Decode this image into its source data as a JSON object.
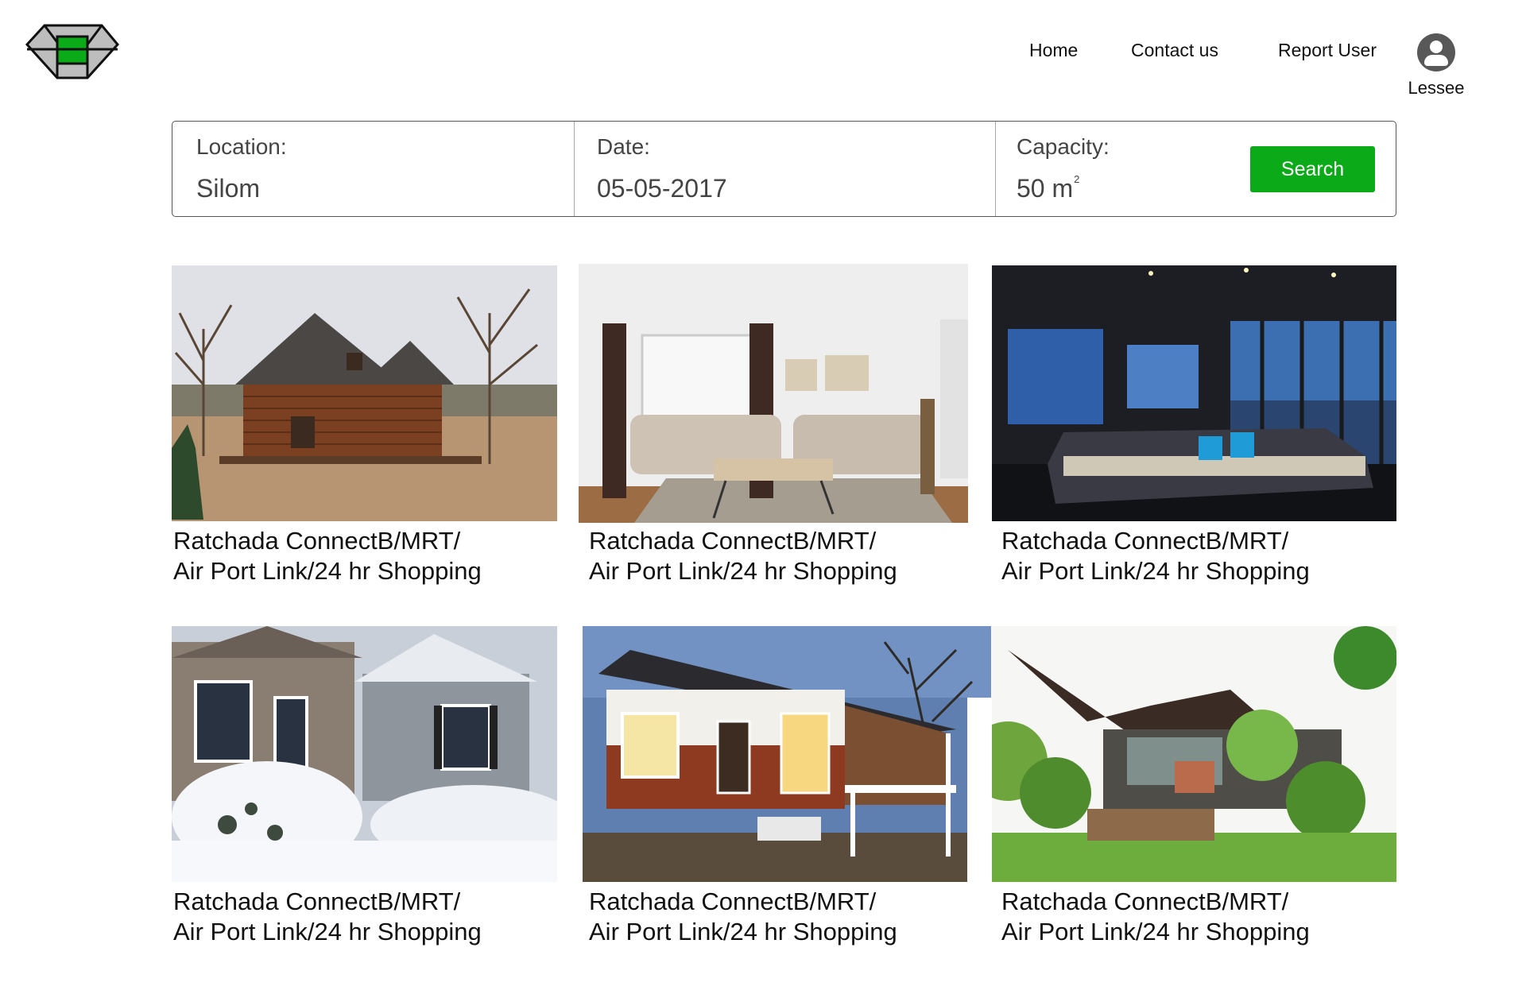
{
  "header": {
    "logo_name": "brand-logo",
    "nav": {
      "home": "Home",
      "contact": "Contact us",
      "report": "Report User"
    },
    "user": {
      "icon": "user-avatar-icon",
      "label": "Lessee"
    }
  },
  "search": {
    "location": {
      "label": "Location:",
      "value": "Silom"
    },
    "date": {
      "label": "Date:",
      "value": "05-05-2017"
    },
    "capacity": {
      "label": "Capacity:",
      "value": "50 m",
      "unit_sup": "2"
    },
    "button_label": "Search",
    "button_color": "#0aaa18"
  },
  "listings": [
    {
      "line1": "Ratchada ConnectB/MRT/",
      "line2": "Air Port Link/24 hr Shopping",
      "image": "log-cabin-photo"
    },
    {
      "line1": "Ratchada ConnectB/MRT/",
      "line2": "Air Port Link/24 hr Shopping",
      "image": "living-room-photo"
    },
    {
      "line1": "Ratchada ConnectB/MRT/",
      "line2": "Air Port Link/24 hr Shopping",
      "image": "penthouse-lounge-photo"
    },
    {
      "line1": "Ratchada ConnectB/MRT/",
      "line2": "Air Port Link/24 hr Shopping",
      "image": "snowy-house-photo"
    },
    {
      "line1": "Ratchada ConnectB/MRT/",
      "line2": "Air Port Link/24 hr Shopping",
      "image": "wooden-stilt-house-photo"
    },
    {
      "line1": "Ratchada ConnectB/MRT/",
      "line2": "Air Port Link/24 hr Shopping",
      "image": "garden-house-photo"
    }
  ]
}
